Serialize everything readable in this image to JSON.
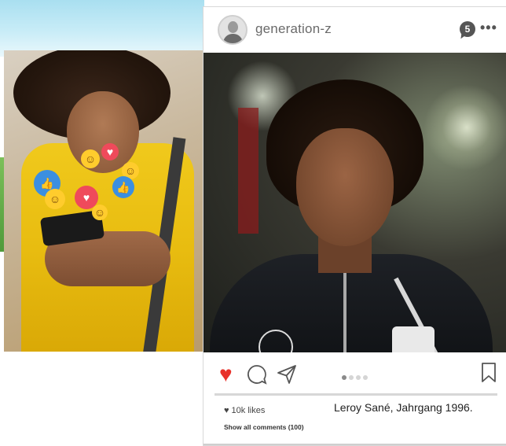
{
  "post": {
    "username": "generation-z",
    "notification_count": "5",
    "more_label": "•••",
    "likes_text": "10k likes",
    "comments_link": "Show all comments (100)",
    "caption": "Leroy Sané, Jahrgang 1996.",
    "carousel": {
      "total": 4,
      "active": 1
    }
  },
  "colors": {
    "like_active": "#e8322b",
    "icon_gray": "#555555"
  },
  "icons": [
    "avatar-icon",
    "notification-icon",
    "more-icon",
    "heart-icon",
    "comment-icon",
    "share-icon",
    "bookmark-icon"
  ]
}
